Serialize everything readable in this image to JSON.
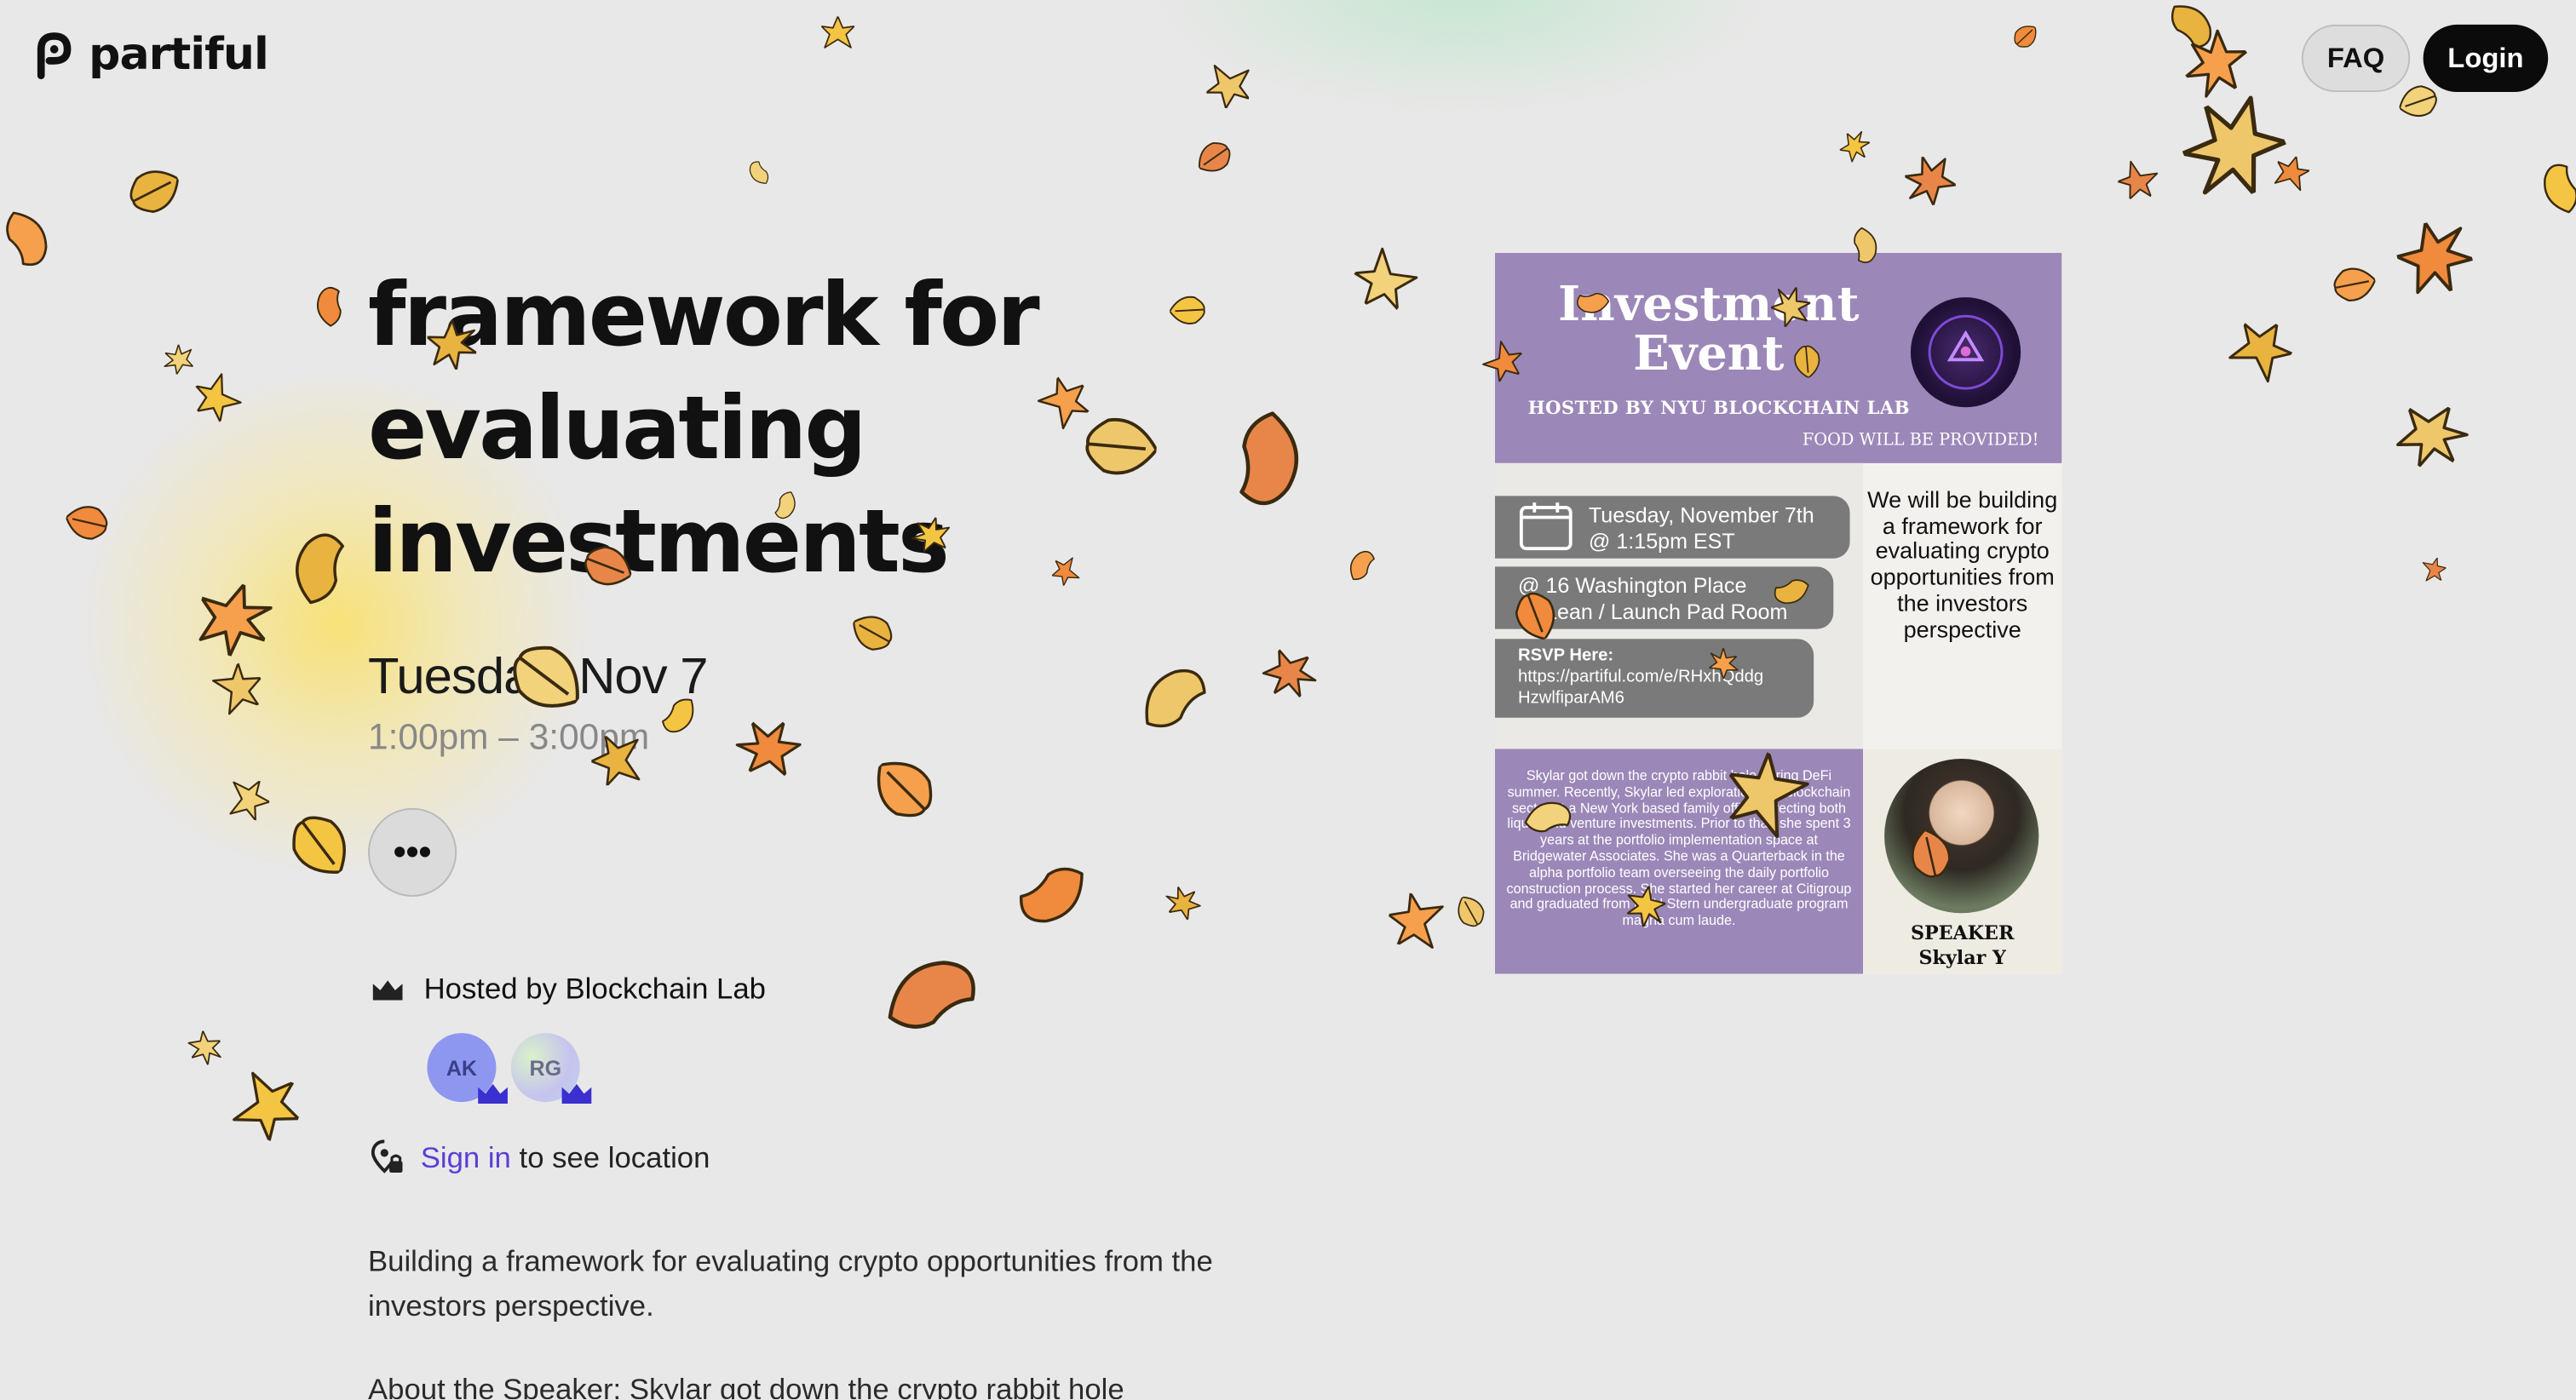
{
  "header": {
    "logo_text": "partiful",
    "faq_label": "FAQ",
    "login_label": "Login"
  },
  "event": {
    "title_lines": [
      "framework for",
      "evaluating",
      "investments"
    ],
    "date": "Tuesday, Nov 7",
    "time": "1:00pm – 3:00pm",
    "more_label": "•••"
  },
  "host": {
    "text": "Hosted by Blockchain Lab",
    "avatars": [
      "AK",
      "RG"
    ]
  },
  "location": {
    "signin_link": "Sign in",
    "suffix": "to see location"
  },
  "description": {
    "para1": "Building a framework for evaluating crypto opportunities from the investors perspective.",
    "para2": "About the Speaker: Skylar got down the crypto rabbit hole"
  },
  "flyer": {
    "title": "Investment Event",
    "hosted_by": "HOSTED BY NYU BLOCKCHAIN LAB",
    "food": "FOOD WILL BE PROVIDED!",
    "when": "Tuesday, November 7th @ 1:15pm EST",
    "where_1": "@ 16 Washington Place",
    "where_2": "→ Lean / Launch Pad Room",
    "rsvp_label": "RSVP Here:",
    "rsvp_url": "https://partiful.com/e/RHxhQddg HzwlfiparAM6",
    "blurb": "We will be building a framework for evaluating crypto opportunities from the investors perspective",
    "bio": "Skylar got down the crypto rabbit hole during DeFi summer. Recently, Skylar led exploration into blockchain sector at a New York based family office, directing both liquid and venture investments. Prior to that, she spent 3 years at the portfolio implementation space at Bridgewater Associates. She was a Quarterback in the alpha portfolio team overseeing the daily portfolio construction process. She started her career at Citigroup and graduated from NYU Stern undergraduate program magna cum laude.",
    "speaker_label": "SPEAKER",
    "speaker_name": "Skylar Y"
  },
  "colors": {
    "background": "#e9e8e8",
    "accent_link": "#5a3fd6",
    "flyer_purple": "#9b87b8",
    "leaf_orange": "#f08a3c",
    "leaf_yellow": "#f4c542"
  }
}
